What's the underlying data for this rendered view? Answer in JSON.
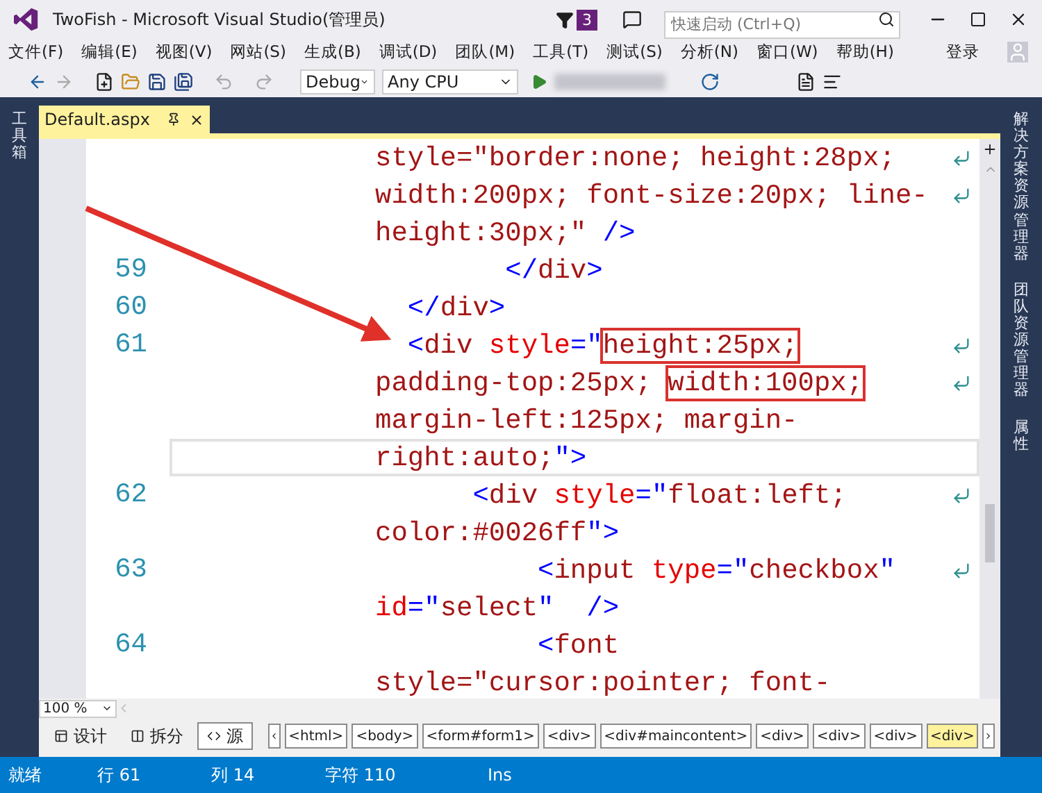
{
  "window": {
    "title": "TwoFish - Microsoft Visual Studio(管理员)",
    "notification_count": "3",
    "search": {
      "placeholder": "快速启动 (Ctrl+Q)"
    }
  },
  "menu": {
    "items": [
      "文件(F)",
      "编辑(E)",
      "视图(V)",
      "网站(S)",
      "生成(B)",
      "调试(D)",
      "团队(M)",
      "工具(T)",
      "测试(S)",
      "分析(N)",
      "窗口(W)",
      "帮助(H)"
    ],
    "sign_in": "登录"
  },
  "toolbar": {
    "configuration": "Debug",
    "platform": "Any CPU"
  },
  "side_panels": {
    "left": [
      "工具箱"
    ],
    "right": [
      "解决方案资源管理器",
      "团队资源管理器",
      "属性"
    ]
  },
  "document_tab": {
    "title": "Default.aspx"
  },
  "editor": {
    "rows": [
      {
        "wrap": true,
        "current": false,
        "segments": [
          {
            "text": "style=\"border:none; height:28px;",
            "kind": "css",
            "boxed": false
          }
        ]
      },
      {
        "wrap": true,
        "current": false,
        "segments": [
          {
            "text": "width:200px; font-size:20px; line-",
            "kind": "css",
            "boxed": false
          }
        ]
      },
      {
        "wrap": false,
        "current": false,
        "segments": [
          {
            "text": "height:30px;\"",
            "kind": "css",
            "boxed": false
          },
          {
            "text": " />",
            "kind": "delim",
            "boxed": false
          }
        ]
      },
      {
        "number": "59",
        "wrap": false,
        "current": false,
        "segments": [
          {
            "text": "        </",
            "kind": "delim",
            "boxed": false
          },
          {
            "text": "div",
            "kind": "tag",
            "boxed": false
          },
          {
            "text": ">",
            "kind": "delim",
            "boxed": false
          }
        ]
      },
      {
        "number": "60",
        "wrap": false,
        "current": false,
        "segments": [
          {
            "text": "  </",
            "kind": "delim",
            "boxed": false
          },
          {
            "text": "div",
            "kind": "tag",
            "boxed": false
          },
          {
            "text": ">",
            "kind": "delim",
            "boxed": false
          }
        ]
      },
      {
        "number": "61",
        "wrap": true,
        "current": false,
        "segments": [
          {
            "text": "  <",
            "kind": "delim",
            "boxed": false
          },
          {
            "text": "div",
            "kind": "tag",
            "boxed": false
          },
          {
            "text": " style",
            "kind": "attr",
            "boxed": false
          },
          {
            "text": "=\"",
            "kind": "delim",
            "boxed": false
          },
          {
            "text": "height:25px;",
            "kind": "css",
            "boxed": true
          }
        ]
      },
      {
        "wrap": true,
        "current": false,
        "segments": [
          {
            "text": "padding-top:25px; ",
            "kind": "css",
            "boxed": false
          },
          {
            "text": "width:100px;",
            "kind": "css",
            "boxed": true
          }
        ]
      },
      {
        "wrap": false,
        "current": false,
        "segments": [
          {
            "text": "margin-left:125px; margin-",
            "kind": "css",
            "boxed": false
          }
        ]
      },
      {
        "wrap": false,
        "current": true,
        "segments": [
          {
            "text": "right:auto;",
            "kind": "css",
            "boxed": false
          },
          {
            "text": "\">",
            "kind": "delim",
            "boxed": false
          }
        ]
      },
      {
        "number": "62",
        "wrap": true,
        "current": false,
        "segments": [
          {
            "text": "      <",
            "kind": "delim",
            "boxed": false
          },
          {
            "text": "div",
            "kind": "tag",
            "boxed": false
          },
          {
            "text": " style",
            "kind": "attr",
            "boxed": false
          },
          {
            "text": "=\"",
            "kind": "delim",
            "boxed": false
          },
          {
            "text": "float:left;",
            "kind": "css",
            "boxed": false
          }
        ]
      },
      {
        "wrap": false,
        "current": false,
        "segments": [
          {
            "text": "color:#0026ff",
            "kind": "css",
            "boxed": false
          },
          {
            "text": "\">",
            "kind": "delim",
            "boxed": false
          }
        ]
      },
      {
        "number": "63",
        "wrap": true,
        "current": false,
        "segments": [
          {
            "text": "          <",
            "kind": "delim",
            "boxed": false
          },
          {
            "text": "input",
            "kind": "tag",
            "boxed": false
          },
          {
            "text": " type",
            "kind": "attr",
            "boxed": false
          },
          {
            "text": "=\"",
            "kind": "delim",
            "boxed": false
          },
          {
            "text": "checkbox",
            "kind": "css",
            "boxed": false
          },
          {
            "text": "\"",
            "kind": "delim",
            "boxed": false
          }
        ]
      },
      {
        "wrap": false,
        "current": false,
        "segments": [
          {
            "text": "id",
            "kind": "attr",
            "boxed": false
          },
          {
            "text": "=\"",
            "kind": "delim",
            "boxed": false
          },
          {
            "text": "select",
            "kind": "css",
            "boxed": false
          },
          {
            "text": "\"  />",
            "kind": "delim",
            "boxed": false
          }
        ]
      },
      {
        "number": "64",
        "wrap": false,
        "current": false,
        "segments": [
          {
            "text": "          <",
            "kind": "delim",
            "boxed": false
          },
          {
            "text": "font",
            "kind": "tag",
            "boxed": false
          }
        ]
      },
      {
        "wrap": false,
        "current": false,
        "segments": [
          {
            "text": "style=\"cursor:pointer; font-",
            "kind": "css",
            "boxed": false
          }
        ]
      }
    ]
  },
  "view_bar": {
    "zoom": "100 %",
    "views": [
      {
        "label": "设计",
        "selected": false
      },
      {
        "label": "拆分",
        "selected": false
      },
      {
        "label": "源",
        "selected": true
      }
    ],
    "breadcrumbs": [
      {
        "label": "<html>",
        "selected": false
      },
      {
        "label": "<body>",
        "selected": false
      },
      {
        "label": "<form#form1>",
        "selected": false
      },
      {
        "label": "<div>",
        "selected": false
      },
      {
        "label": "<div#maincontent>",
        "selected": false
      },
      {
        "label": "<div>",
        "selected": false
      },
      {
        "label": "<div>",
        "selected": false
      },
      {
        "label": "<div>",
        "selected": false
      },
      {
        "label": "<div>",
        "selected": true
      }
    ]
  },
  "status_bar": {
    "state": "就绪",
    "line": "行 61",
    "column": "列 14",
    "char": "字符 110",
    "mode": "Ins"
  }
}
